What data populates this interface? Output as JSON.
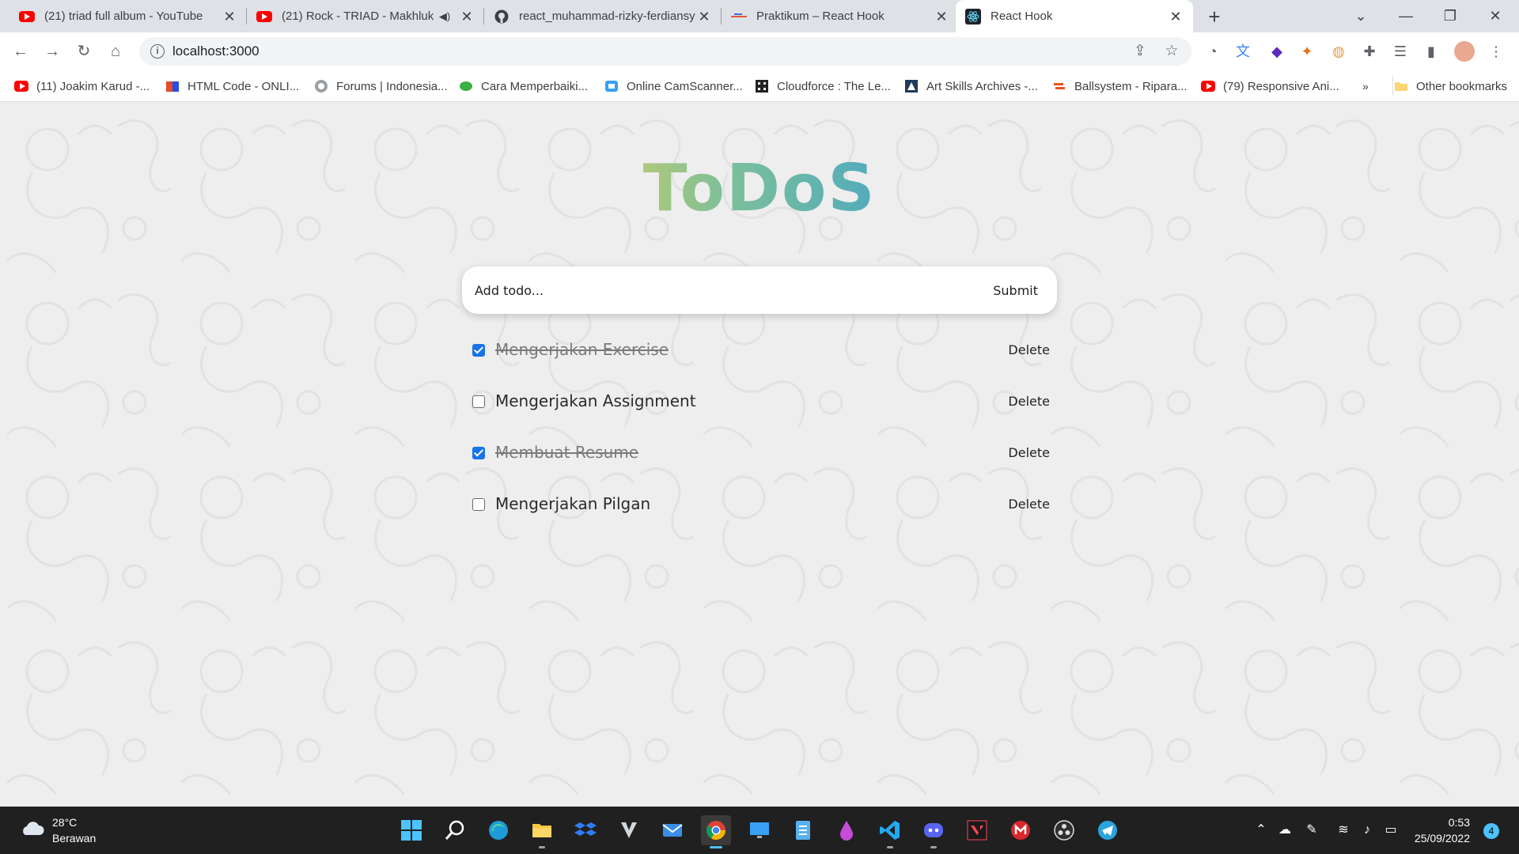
{
  "browser": {
    "tabs": [
      {
        "title": "(21) triad full album - YouTube",
        "icon": "youtube-icon"
      },
      {
        "title": "(21) Rock - TRIAD - Makhluk",
        "icon": "youtube-icon"
      },
      {
        "title": "react_muhammad-rizky-ferdiansy",
        "icon": "github-icon"
      },
      {
        "title": "Praktikum – React Hook",
        "icon": "alterra-icon"
      },
      {
        "title": "React Hook",
        "icon": "react-icon"
      }
    ],
    "active_tab": 4,
    "url": "localhost:3000",
    "bookmarks": [
      {
        "label": "(11) Joakim Karud -...",
        "icon": "youtube-icon"
      },
      {
        "label": "HTML Code - ONLI...",
        "icon": "html-code-icon"
      },
      {
        "label": "Forums | Indonesia...",
        "icon": "forum-icon"
      },
      {
        "label": "Cara Memperbaiki...",
        "icon": "leaf-icon"
      },
      {
        "label": "Online CamScanner...",
        "icon": "camscanner-icon"
      },
      {
        "label": "Cloudforce : The Le...",
        "icon": "grid-icon"
      },
      {
        "label": "Art Skills Archives -...",
        "icon": "art-icon"
      },
      {
        "label": "Ballsystem - Ripara...",
        "icon": "ball-icon"
      },
      {
        "label": "(79) Responsive Ani...",
        "icon": "youtube-icon"
      }
    ],
    "other_bookmarks": "Other bookmarks"
  },
  "app": {
    "title": "ToDoS",
    "input_placeholder": "Add todo...",
    "submit_label": "Submit",
    "delete_label": "Delete",
    "todos": [
      {
        "text": "Mengerjakan Exercise",
        "completed": true
      },
      {
        "text": "Mengerjakan Assignment",
        "completed": false
      },
      {
        "text": "Membuat Resume",
        "completed": true
      },
      {
        "text": "Mengerjakan Pilgan",
        "completed": false
      }
    ]
  },
  "taskbar": {
    "weather_temp": "28°C",
    "weather_desc": "Berawan",
    "time": "0:53",
    "date": "25/09/2022",
    "notification_count": "4"
  },
  "colors": {
    "title_gradient": [
      "#c8cc6e",
      "#7cbf9a",
      "#47a6c5"
    ],
    "checkbox_checked": "#1a73e8",
    "taskbar_bg": "#202020",
    "page_bg": "#eeeeee"
  }
}
